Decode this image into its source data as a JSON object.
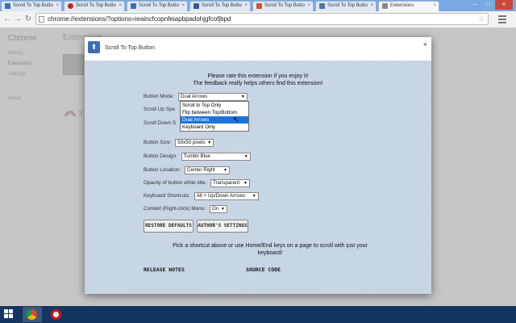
{
  "tabs": [
    {
      "label": "Scroll To Top Butto",
      "icon": "scroll-to-top-favicon",
      "color": "#3d6fb0"
    },
    {
      "label": "Scroll To Top Butto",
      "icon": "opera-favicon",
      "color": "#d02020"
    },
    {
      "label": "Scroll To Top Butto",
      "icon": "scroll-to-top-favicon",
      "color": "#3d6fb0"
    },
    {
      "label": "Scroll To Top Butto",
      "icon": "facebook-favicon",
      "color": "#3b5998"
    },
    {
      "label": "Scroll To Top Butto",
      "icon": "google-plus-favicon",
      "color": "#dd4b39"
    },
    {
      "label": "Scroll To Top Butto",
      "icon": "vk-favicon",
      "color": "#4c75a3"
    },
    {
      "label": "Extensions",
      "icon": "puzzle-favicon",
      "color": "#888888"
    }
  ],
  "address_bar": {
    "url": "chrome://extensions/?options=ieaincfcopnfeiapbpadohjgfcofjbpd"
  },
  "background_page": {
    "title": "Chrome",
    "nav": [
      "History",
      "Extensions",
      "Settings",
      "About"
    ],
    "header": "Extensions",
    "extension_name_fragment": "S"
  },
  "dialog": {
    "title": "Scroll To Top Button",
    "close": "×",
    "rate_line1": "Please rate this extension if you enjoy it!",
    "rate_line2": "The feedback really helps others find this extension!",
    "button_mode": {
      "label": "Button Mode:",
      "value": "Dual Arrows"
    },
    "mode_options": [
      "Scroll to Top Only",
      "Flip between Top/Bottom",
      "Dual Arrows",
      "Keyboard Only"
    ],
    "mode_highlighted": "Dual Arrows",
    "scroll_up_speed": {
      "label": "Scroll Up Spe"
    },
    "scroll_down_speed": {
      "label": "Scroll Down S"
    },
    "button_size": {
      "label": "Button Size:",
      "value": "50x50 pixels"
    },
    "button_design": {
      "label": "Button Design:",
      "value": "Tumblr Blue"
    },
    "button_location": {
      "label": "Button Location:",
      "value": "Center Right"
    },
    "opacity_idle": {
      "label": "Opacity of button while idle:",
      "value": "Transparent"
    },
    "keyboard_shortcuts": {
      "label": "Keyboard Shortcuts:",
      "value": "Alt + Up/Down Arrows"
    },
    "context_menu": {
      "label": "Context (Right-click) Menu:",
      "value": "On"
    },
    "restore_defaults": "RESTORE DEFAULTS",
    "authors_settings": "AUTHOR'S SETTINGS",
    "hint_line1": "Pick a shortcut above or use Home/End keys on a page to scroll with just your",
    "hint_line2": "keyboard!",
    "release_notes": "RELEASE NOTES",
    "source_code": "SOURCE CODE"
  },
  "taskbar": {
    "apps": [
      {
        "name": "chrome-icon",
        "active": true
      },
      {
        "name": "opera-icon",
        "active": false
      }
    ]
  },
  "colors": {
    "accent": "#3d6fb0",
    "panel": "#c9d6e6",
    "highlight": "#1e73d8",
    "taskbar": "#14355f"
  }
}
